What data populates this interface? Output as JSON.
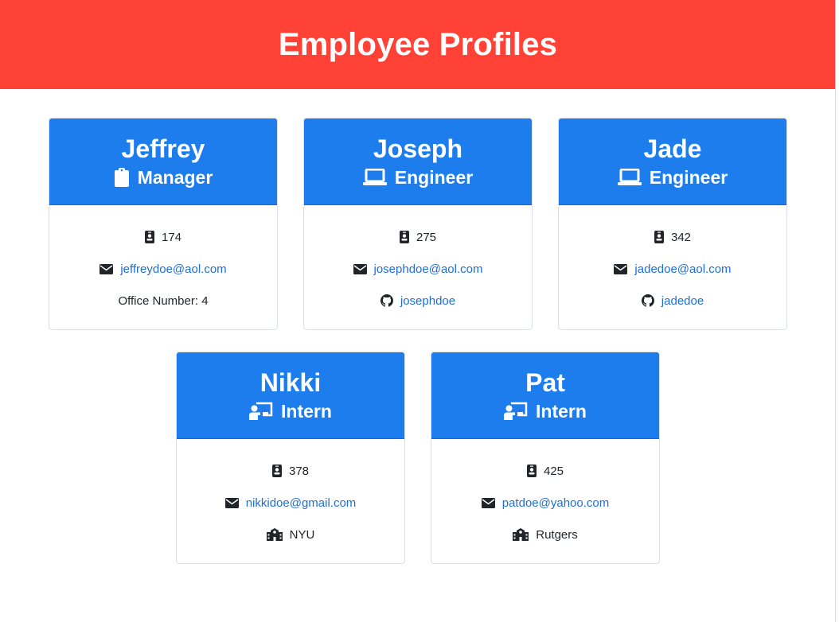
{
  "page": {
    "title": "Employee Profiles"
  },
  "employees": [
    {
      "name": "Jeffrey",
      "role": "Manager",
      "role_icon": "clipboard-icon",
      "id": "174",
      "email": "jeffreydoe@aol.com",
      "extra_type": "office",
      "extra": "Office Number: 4"
    },
    {
      "name": "Joseph",
      "role": "Engineer",
      "role_icon": "laptop-icon",
      "id": "275",
      "email": "josephdoe@aol.com",
      "extra_type": "github",
      "extra": "josephdoe"
    },
    {
      "name": "Jade",
      "role": "Engineer",
      "role_icon": "laptop-icon",
      "id": "342",
      "email": "jadedoe@aol.com",
      "extra_type": "github",
      "extra": "jadedoe"
    },
    {
      "name": "Nikki",
      "role": "Intern",
      "role_icon": "chalkboard-teacher-icon",
      "id": "378",
      "email": "nikkidoe@gmail.com",
      "extra_type": "school",
      "extra": "NYU"
    },
    {
      "name": "Pat",
      "role": "Intern",
      "role_icon": "chalkboard-teacher-icon",
      "id": "425",
      "email": "patdoe@yahoo.com",
      "extra_type": "school",
      "extra": "Rutgers"
    }
  ],
  "colors": {
    "banner": "#ff4136",
    "card_header": "#1e7ded",
    "link": "#1e6fd9"
  }
}
